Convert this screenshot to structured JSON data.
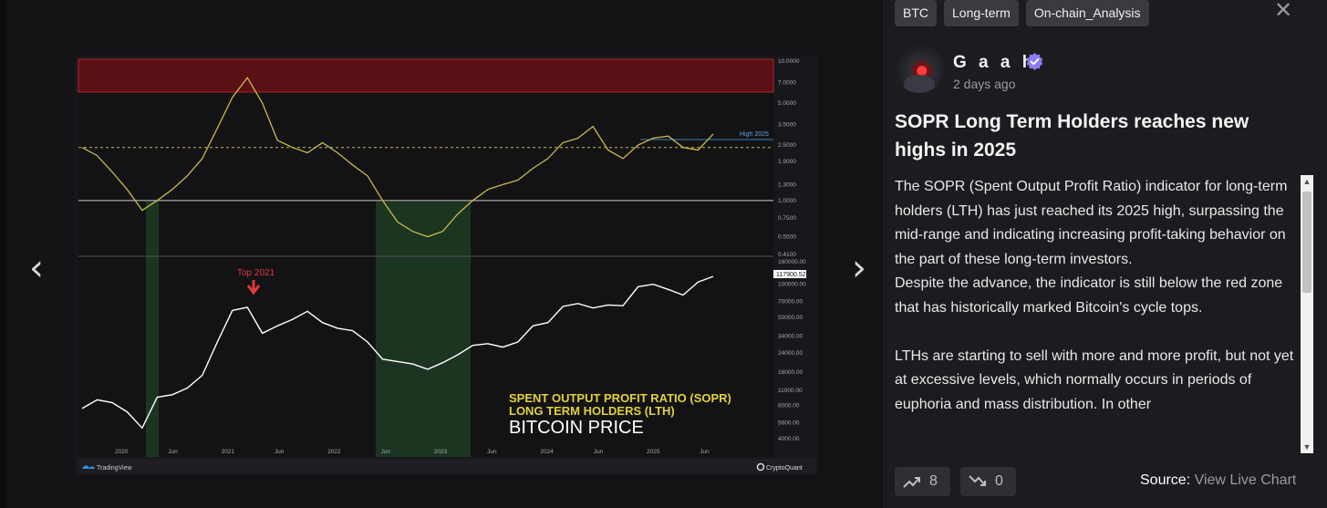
{
  "tags": [
    "BTC",
    "Long-term",
    "On-chain_Analysis"
  ],
  "author": {
    "name": "G a a h",
    "time": "2 days ago"
  },
  "post": {
    "title": "SOPR Long Term Holders reaches new highs in 2025",
    "body": "The SOPR (Spent Output Profit Ratio) indicator for long-term holders (LTH) has just reached its 2025 high, surpassing the mid-range and indicating increasing profit-taking behavior on the part of these long-term investors.\nDespite the advance, the indicator is still below the red zone that has historically marked Bitcoin's cycle tops.\n\nLTHs are starting to sell with more and more profit, but not yet at excessive levels, which normally occurs in periods of euphoria and mass distribution. In other"
  },
  "votes": {
    "up": "8",
    "down": "0"
  },
  "source": {
    "label": "Source:",
    "link": "View Live Chart"
  },
  "icons": {
    "prev": "chevron-left-icon",
    "next": "chevron-right-icon",
    "close": "close-icon",
    "verified": "verified-badge-icon",
    "up": "trending-up-icon",
    "down": "trending-down-icon"
  },
  "colors": {
    "accent": "#8b7cf6",
    "sopr_line": "#c9b84a",
    "price_line": "#ffffff",
    "red_zone": "#5a1014",
    "green_zone": "#1e3a22",
    "title_yellow": "#e2d13a"
  },
  "chart_data": {
    "type": "line",
    "upper_y_ticks": [
      "10.0000",
      "7.0000",
      "5.0000",
      "3.5000",
      "2.5000",
      "1.9000",
      "1.3000",
      "1.0000",
      "0.7500",
      "0.5500",
      "0.4100"
    ],
    "lower_y_ticks": [
      "160000.00",
      "100000.00",
      "70000.00",
      "50000.00",
      "34000.00",
      "24000.00",
      "16000.00",
      "11000.00",
      "8000.00",
      "5600.00",
      "4000.00"
    ],
    "x_ticks": [
      "2020",
      "Jun",
      "2021",
      "Jun",
      "2022",
      "Jun",
      "2023",
      "Jun",
      "2024",
      "Jun",
      "2025",
      "Jun"
    ],
    "price_label": "117900.52",
    "annotations": {
      "high": "High 2025",
      "top": "Top 2021"
    },
    "legend": [
      "SPENT OUTPUT PROFIT RATIO (SOPR)",
      "LONG TERM HOLDERS (LTH)",
      "BITCOIN PRICE"
    ],
    "brand_left": "TradingView",
    "brand_right": "CryptoQuant",
    "red_zone_min": 6.0,
    "reference_lines": [
      2.4,
      1.0
    ],
    "series": [
      {
        "values": [
          2.4,
          2.1,
          1.6,
          1.2,
          0.85,
          1.0,
          1.2,
          1.5,
          2.0,
          3.3,
          5.5,
          7.6,
          5.0,
          2.7,
          2.4,
          2.2,
          2.6,
          2.2,
          1.8,
          1.5,
          1.0,
          0.7,
          0.6,
          0.55,
          0.6,
          0.8,
          1.0,
          1.2,
          1.3,
          1.4,
          1.7,
          2.0,
          2.6,
          2.8,
          3.4,
          2.3,
          2.0,
          2.5,
          2.8,
          2.9,
          2.4,
          2.3,
          3.0
        ]
      },
      {
        "values": [
          7500,
          9000,
          8500,
          7000,
          5000,
          9500,
          10000,
          11500,
          15000,
          30000,
          58000,
          62000,
          36000,
          42000,
          48000,
          57000,
          45000,
          40000,
          38000,
          30000,
          21000,
          20000,
          19000,
          17000,
          19500,
          23000,
          28000,
          29000,
          27000,
          30000,
          42000,
          45000,
          63000,
          67000,
          61000,
          65000,
          64000,
          95000,
          100000,
          90000,
          80000,
          105000,
          117900
        ]
      }
    ]
  }
}
